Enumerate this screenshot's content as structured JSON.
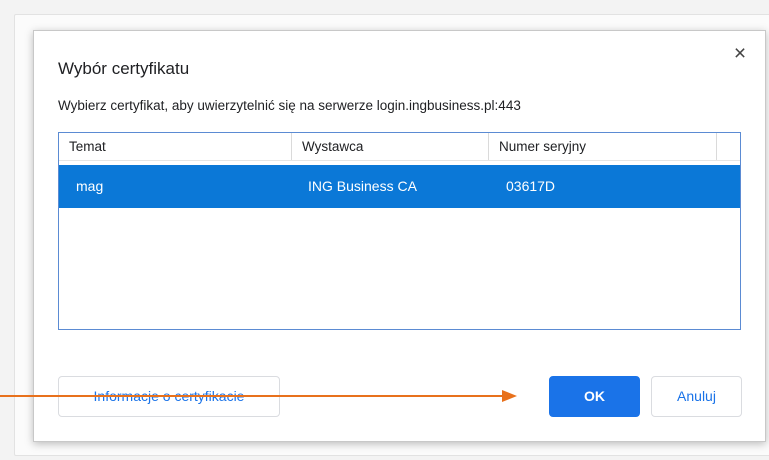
{
  "dialog": {
    "title": "Wybór certyfikatu",
    "subtitle": "Wybierz certyfikat, aby uwierzytelnić się na serwerze login.ingbusiness.pl:443",
    "close_icon": "×",
    "table": {
      "columns": [
        "Temat",
        "Wystawca",
        "Numer seryjny"
      ],
      "rows": [
        {
          "subject": "mag",
          "issuer": "ING Business CA",
          "serial": "03617D"
        }
      ]
    },
    "buttons": {
      "info": "Informacje o certyfikacie",
      "ok": "OK",
      "cancel": "Anuluj"
    }
  },
  "colors": {
    "accent": "#1a73e8",
    "selection": "#0b78d7",
    "annotation_arrow": "#e8711c"
  }
}
